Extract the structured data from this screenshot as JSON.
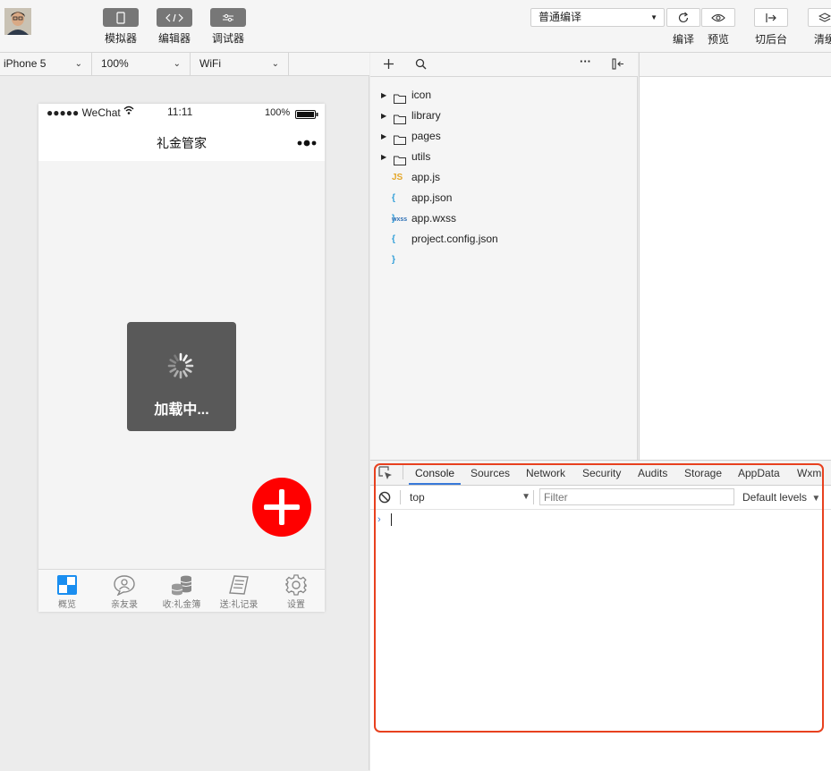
{
  "toolbar": {
    "simulator": "模拟器",
    "editor": "编辑器",
    "debugger": "调试器",
    "compile_mode": "普通编译",
    "compile": "编译",
    "preview": "预览",
    "background": "切后台",
    "clear_cache": "清缓"
  },
  "devicebar": {
    "device": "iPhone 5",
    "zoom": "100%",
    "network": "WiFi"
  },
  "phone": {
    "status_signal": "●●●●● WeChat",
    "status_time": "11:11",
    "status_battery": "100%",
    "title": "礼金管家",
    "loading_text": "加载中...",
    "tabs": [
      {
        "label": "概览"
      },
      {
        "label": "亲友录"
      },
      {
        "label": "收:礼金簿"
      },
      {
        "label": "送:礼记录"
      },
      {
        "label": "设置"
      }
    ]
  },
  "filetree": {
    "folders": [
      "icon",
      "library",
      "pages",
      "utils"
    ],
    "files": [
      {
        "badge": "JS",
        "name": "app.js"
      },
      {
        "badge": "{ }",
        "name": "app.json"
      },
      {
        "badge": "wxss",
        "name": "app.wxss"
      },
      {
        "badge": "{ }",
        "name": "project.config.json"
      }
    ]
  },
  "devtools": {
    "tabs": [
      "Console",
      "Sources",
      "Network",
      "Security",
      "Audits",
      "Storage",
      "AppData",
      "Wxm"
    ],
    "active_tab": "Console",
    "context": "top",
    "filter_placeholder": "Filter",
    "levels": "Default levels",
    "prompt": "›"
  },
  "colors": {
    "accent": "#3879d9",
    "fab": "#ff0000",
    "highlight": "#e8411f",
    "loading_bg": "#595959"
  }
}
